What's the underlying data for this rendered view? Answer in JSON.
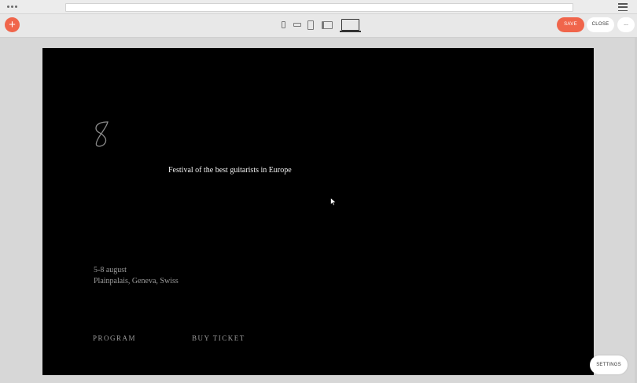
{
  "toolbar": {
    "add_label": "+",
    "save_label": "SAVE",
    "close_label": "CLOSE",
    "more_label": "..."
  },
  "page": {
    "tagline": "Festival of the best guitarists in Europe",
    "date": "5-8 august",
    "location": "Plainpalais, Geneva, Swiss",
    "nav_program": "PROGRAM",
    "nav_buy_ticket": "BUY TICKET"
  },
  "settings_label": "SETTINGS",
  "colors": {
    "accent": "#f0654b",
    "page_background": "#000000",
    "canvas_background": "#d7d7d7"
  },
  "icons": {
    "logo": "s-logo-icon",
    "add": "plus-icon",
    "devices": [
      "phone-portrait-icon",
      "phone-landscape-icon",
      "tablet-portrait-icon",
      "tablet-landscape-icon",
      "desktop-icon"
    ],
    "menu": "hamburger-icon",
    "cursor": "mouse-cursor-icon"
  }
}
